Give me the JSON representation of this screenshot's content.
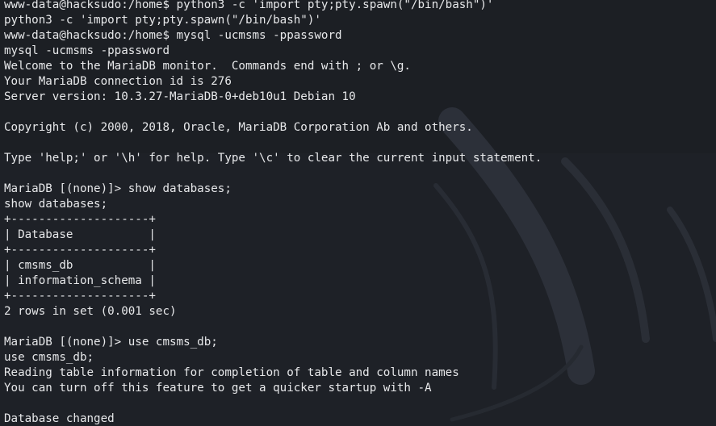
{
  "colors": {
    "background": "#1f2228",
    "text": "#e7e8ea",
    "wallpaper_stroke": "#2f3541"
  },
  "terminal": {
    "lines": [
      "www-data@hacksudo:/home$ python3 -c 'import pty;pty.spawn(\"/bin/bash\")'",
      "python3 -c 'import pty;pty.spawn(\"/bin/bash\")'",
      "www-data@hacksudo:/home$ mysql -ucmsms -ppassword",
      "mysql -ucmsms -ppassword",
      "Welcome to the MariaDB monitor.  Commands end with ; or \\g.",
      "Your MariaDB connection id is 276",
      "Server version: 10.3.27-MariaDB-0+deb10u1 Debian 10",
      "",
      "Copyright (c) 2000, 2018, Oracle, MariaDB Corporation Ab and others.",
      "",
      "Type 'help;' or '\\h' for help. Type '\\c' to clear the current input statement.",
      "",
      "MariaDB [(none)]> show databases;",
      "show databases;",
      "+--------------------+",
      "| Database           |",
      "+--------------------+",
      "| cmsms_db           |",
      "| information_schema |",
      "+--------------------+",
      "2 rows in set (0.001 sec)",
      "",
      "MariaDB [(none)]> use cmsms_db;",
      "use cmsms_db;",
      "Reading table information for completion of table and column names",
      "You can turn off this feature to get a quicker startup with -A",
      "",
      "Database changed"
    ]
  }
}
